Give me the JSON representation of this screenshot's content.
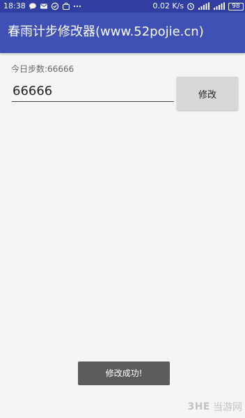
{
  "status_bar": {
    "time": "18:38",
    "net_speed": "0.02 K/s",
    "battery": "98"
  },
  "app_bar": {
    "title": "春雨计步修改器(www.52pojie.cn)"
  },
  "main": {
    "today_steps_label": "今日步数:66666",
    "steps_input_value": "66666",
    "modify_button_label": "修改"
  },
  "toast": {
    "message": "修改成功!"
  },
  "watermark": {
    "brand": "3HE",
    "site": "当游网"
  },
  "colors": {
    "status_bar": "#2f3ea0",
    "app_bar": "#3f51b5",
    "background": "#f5f5f5",
    "button": "#d6d7d7",
    "toast": "#5c5c5c"
  },
  "icons": {
    "status_left": [
      "chat-bubble-icon",
      "mail-icon",
      "check-circle-icon",
      "bag-icon",
      "more-dots-icon"
    ],
    "status_right": [
      "alarm-icon",
      "wifi-signal-icon",
      "cell-signal-icon",
      "battery-icon"
    ]
  }
}
